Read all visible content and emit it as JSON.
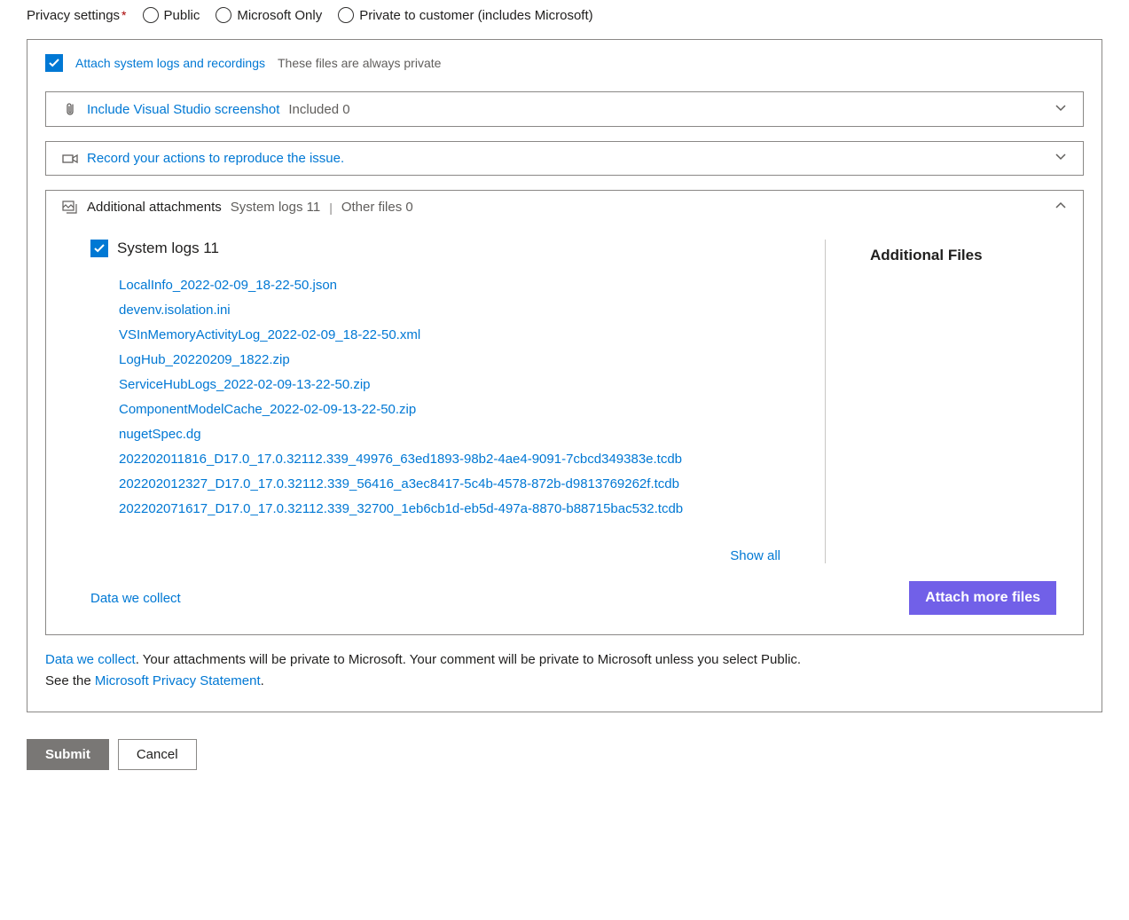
{
  "privacy": {
    "label": "Privacy settings",
    "required_marker": "*",
    "options": [
      "Public",
      "Microsoft Only",
      "Private to customer (includes Microsoft)"
    ]
  },
  "attach_checkbox": {
    "label": "Attach system logs and recordings",
    "note": "These files are always private"
  },
  "screenshot_panel": {
    "title": "Include Visual Studio screenshot",
    "sub": "Included 0"
  },
  "record_panel": {
    "title": "Record your actions to reproduce the issue."
  },
  "attachments_panel": {
    "title": "Additional attachments",
    "sub1": "System logs 11",
    "pipe": "|",
    "sub2": "Other files 0",
    "logs_heading": "System logs 11",
    "files": [
      "LocalInfo_2022-02-09_18-22-50.json",
      "devenv.isolation.ini",
      "VSInMemoryActivityLog_2022-02-09_18-22-50.xml",
      "LogHub_20220209_1822.zip",
      "ServiceHubLogs_2022-02-09-13-22-50.zip",
      "ComponentModelCache_2022-02-09-13-22-50.zip",
      "nugetSpec.dg",
      "202202011816_D17.0_17.0.32112.339_49976_63ed1893-98b2-4ae4-9091-7cbcd349383e.tcdb",
      "202202012327_D17.0_17.0.32112.339_56416_a3ec8417-5c4b-4578-872b-d9813769262f.tcdb",
      "202202071617_D17.0_17.0.32112.339_32700_1eb6cb1d-eb5d-497a-8870-b88715bac532.tcdb"
    ],
    "show_all": "Show all",
    "additional_files_heading": "Additional Files",
    "data_we_collect": "Data we collect",
    "attach_more": "Attach more files"
  },
  "legal": {
    "link1": "Data we collect",
    "text1": ". Your attachments will be private to Microsoft. Your comment will be private to Microsoft unless you select Public.",
    "text2": "See the ",
    "link2": "Microsoft Privacy Statement",
    "text3": "."
  },
  "buttons": {
    "submit": "Submit",
    "cancel": "Cancel"
  }
}
